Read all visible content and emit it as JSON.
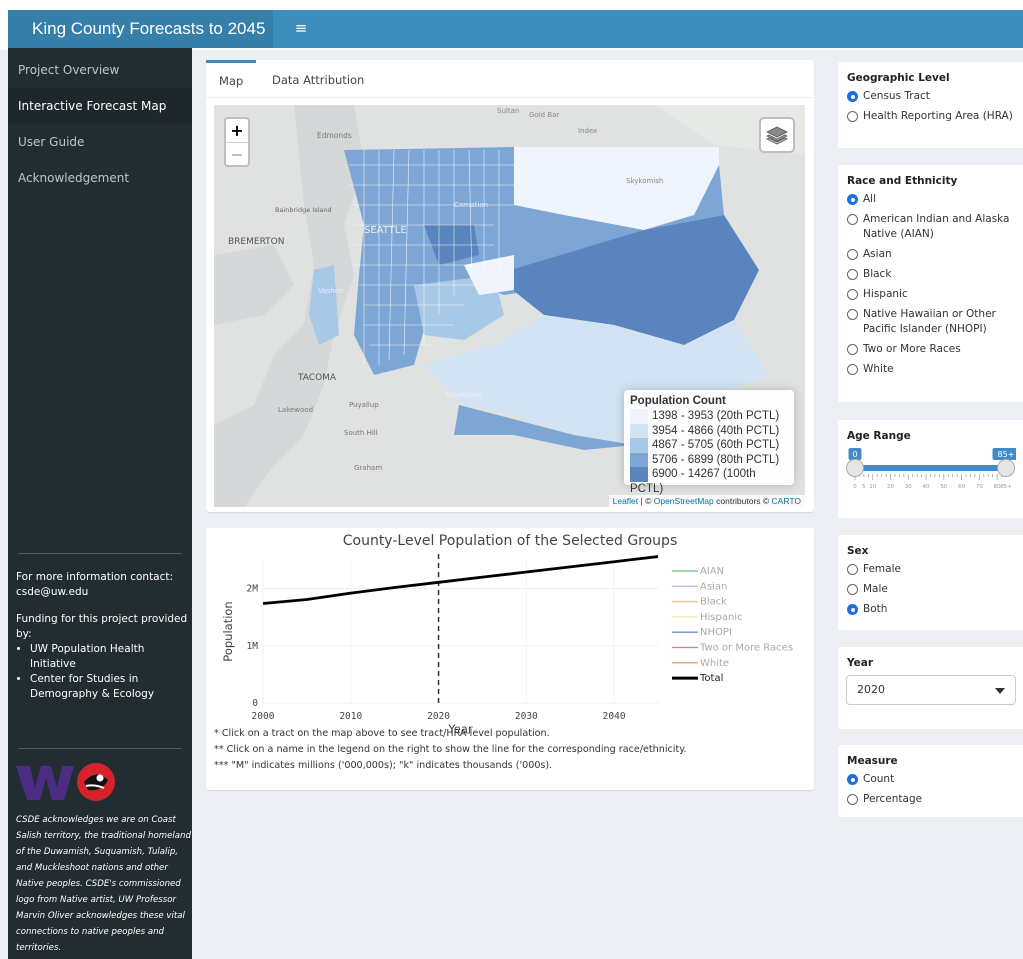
{
  "header": {
    "title": "King County Forecasts to 2045",
    "menu_icon": "hamburger-icon"
  },
  "sidebar": {
    "items": [
      {
        "label": "Project Overview"
      },
      {
        "label": "Interactive Forecast Map"
      },
      {
        "label": "User Guide"
      },
      {
        "label": "Acknowledgement"
      }
    ],
    "contact_line1": "For more information contact:",
    "contact_email": "csde@uw.edu",
    "funding_text": "Funding for this project provided by:",
    "funders": [
      "UW Population Health Initiative",
      "Center for Studies in Demography & Ecology"
    ],
    "acknowledgement": "CSDE acknowledges we are on Coast Salish territory, the traditional homeland of the Duwamish, Suquamish, Tulalip, and Muckleshoot nations and other Native peoples. CSDE's commissioned logo from Native artist, UW Professor Marvin Oliver acknowledges these vital connections to native peoples and territories."
  },
  "tabs": [
    {
      "label": "Map"
    },
    {
      "label": "Data Attribution"
    }
  ],
  "map": {
    "zoom_in": "+",
    "zoom_out": "−",
    "places": {
      "edmonds": "Edmonds",
      "sultan": "Sultan",
      "gold_bar": "Gold Bar",
      "index": "Index",
      "skykomish": "Skykomish",
      "bainbridge": "Bainbridge Island",
      "bremerton": "BREMERTON",
      "seattle": "SEATTLE",
      "carnation": "Carnation",
      "vashon": "Vashon",
      "tacoma": "TACOMA",
      "puyallup": "Puyallup",
      "lakewood": "Lakewood",
      "south_hill": "South Hill",
      "graham": "Graham",
      "enumclaw": "Enumclaw",
      "kent": "Kent"
    },
    "legend": {
      "title": "Population Count",
      "entries": [
        {
          "label": "1398 - 3953 (20th PCTL)",
          "color": "#f0f4fc"
        },
        {
          "label": "3954 - 4866 (40th PCTL)",
          "color": "#d2e3f3"
        },
        {
          "label": "4867 - 5705 (60th PCTL)",
          "color": "#a7c8e6"
        },
        {
          "label": "5706 - 6899 (80th PCTL)",
          "color": "#7ea6d4"
        },
        {
          "label": "6900 - 14267 (100th PCTL)",
          "color": "#5a84bd"
        }
      ]
    },
    "attribution": {
      "leaflet": "Leaflet",
      "osm_prefix": "| ©",
      "osm": "OpenStreetMap",
      "contributors": "contributors ©",
      "carto": "CARTO"
    }
  },
  "chart_data": {
    "type": "line",
    "title": "County-Level Population of the Selected Groups",
    "xlabel": "Year",
    "ylabel": "Population",
    "x_ticks": [
      "2000",
      "2010",
      "2020",
      "2030",
      "2040"
    ],
    "y_ticks": [
      "0",
      "1M",
      "2M"
    ],
    "xlim": [
      2000,
      2045
    ],
    "ylim": [
      0,
      2500000
    ],
    "vline_x": 2020,
    "series": [
      {
        "name": "AIAN",
        "color": "#6cbf7a",
        "values": null
      },
      {
        "name": "Asian",
        "color": "#b9b8e8",
        "values": null
      },
      {
        "name": "Black",
        "color": "#f5b88d",
        "values": null
      },
      {
        "name": "Hispanic",
        "color": "#f3e7a6",
        "values": null
      },
      {
        "name": "NHOPI",
        "color": "#6b8ec8",
        "values": null
      },
      {
        "name": "Two or More Races",
        "color": "#ec6aa6",
        "values": null
      },
      {
        "name": "White",
        "color": "#e8a07e",
        "values": null
      },
      {
        "name": "Total",
        "color": "#000000",
        "x": [
          2000,
          2005,
          2010,
          2015,
          2020,
          2025,
          2030,
          2035,
          2040,
          2045
        ],
        "values": [
          1740000,
          1810000,
          1920000,
          2020000,
          2110000,
          2200000,
          2290000,
          2380000,
          2470000,
          2560000
        ]
      }
    ]
  },
  "chart_notes": [
    "* Click on a tract on the map above to see tract/HRA-level population.",
    "** Click on a name in the legend on the right to show the line for the corresponding race/ethnicity.",
    "*** \"M\" indicates millions ('000,000s); \"k\" indicates thousands ('000s)."
  ],
  "controls": {
    "geo": {
      "heading": "Geographic Level",
      "options": [
        "Census Tract",
        "Health Reporting Area (HRA)"
      ],
      "selected": 0
    },
    "race": {
      "heading": "Race and Ethnicity",
      "options": [
        "All",
        "American Indian and Alaska Native (AIAN)",
        "Asian",
        "Black",
        "Hispanic",
        "Native Hawaiian or Other Pacific Islander (NHOPI)",
        "Two or More Races",
        "White"
      ],
      "selected": 0
    },
    "age": {
      "heading": "Age Range",
      "min_label": "0",
      "max_label": "85+",
      "from": 0,
      "to": 85,
      "ticks": [
        "0",
        "5",
        "10",
        "20",
        "30",
        "40",
        "50",
        "60",
        "70",
        "80",
        "85+"
      ]
    },
    "sex": {
      "heading": "Sex",
      "options": [
        "Female",
        "Male",
        "Both"
      ],
      "selected": 2
    },
    "year": {
      "heading": "Year",
      "value": "2020"
    },
    "measure": {
      "heading": "Measure",
      "options": [
        "Count",
        "Percentage"
      ],
      "selected": 0
    }
  }
}
